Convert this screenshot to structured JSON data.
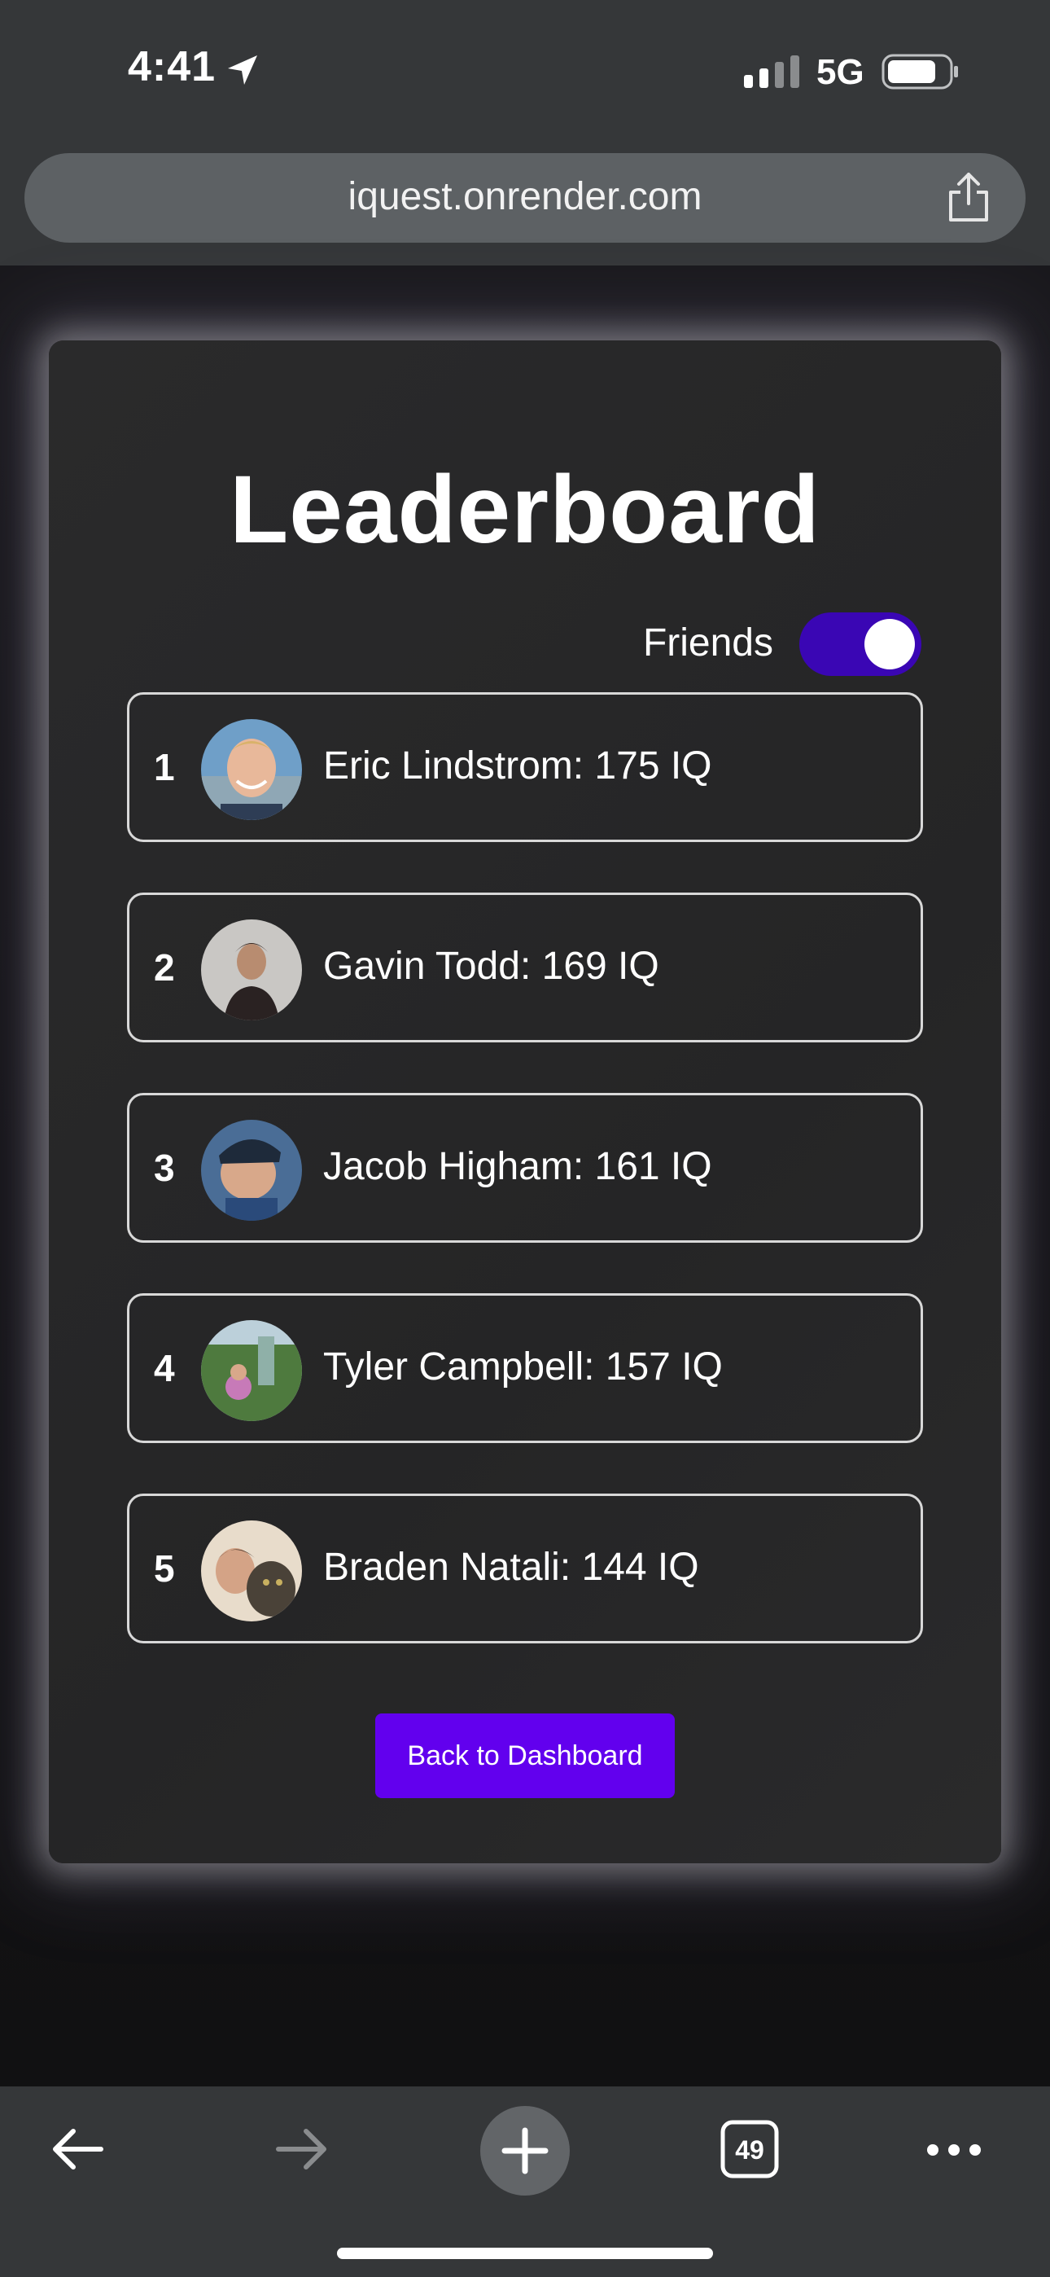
{
  "status_bar": {
    "time": "4:41",
    "network": "5G",
    "icons": [
      "location-arrow-icon",
      "signal-bars-icon",
      "battery-icon"
    ]
  },
  "browser": {
    "url": "iquest.onrender.com",
    "share_icon": "share-icon",
    "tab_count": "49",
    "toolbar_icons": [
      "back-arrow-icon",
      "forward-arrow-icon",
      "new-tab-plus-icon",
      "tabs-icon",
      "more-icon"
    ]
  },
  "leaderboard": {
    "title": "Leaderboard",
    "toggle_label": "Friends",
    "toggle_on": true,
    "entries": [
      {
        "rank": "1",
        "text": "Eric Lindstrom: 175 IQ"
      },
      {
        "rank": "2",
        "text": "Gavin Todd: 169 IQ"
      },
      {
        "rank": "3",
        "text": "Jacob Higham: 161 IQ"
      },
      {
        "rank": "4",
        "text": "Tyler Campbell: 157 IQ"
      },
      {
        "rank": "5",
        "text": "Braden Natali: 144 IQ"
      }
    ],
    "back_button_label": "Back to Dashboard"
  },
  "colors": {
    "accent": "#6200ee",
    "toggle": "#3a06b4",
    "card": "#2a2a2b",
    "chrome": "#353739"
  }
}
